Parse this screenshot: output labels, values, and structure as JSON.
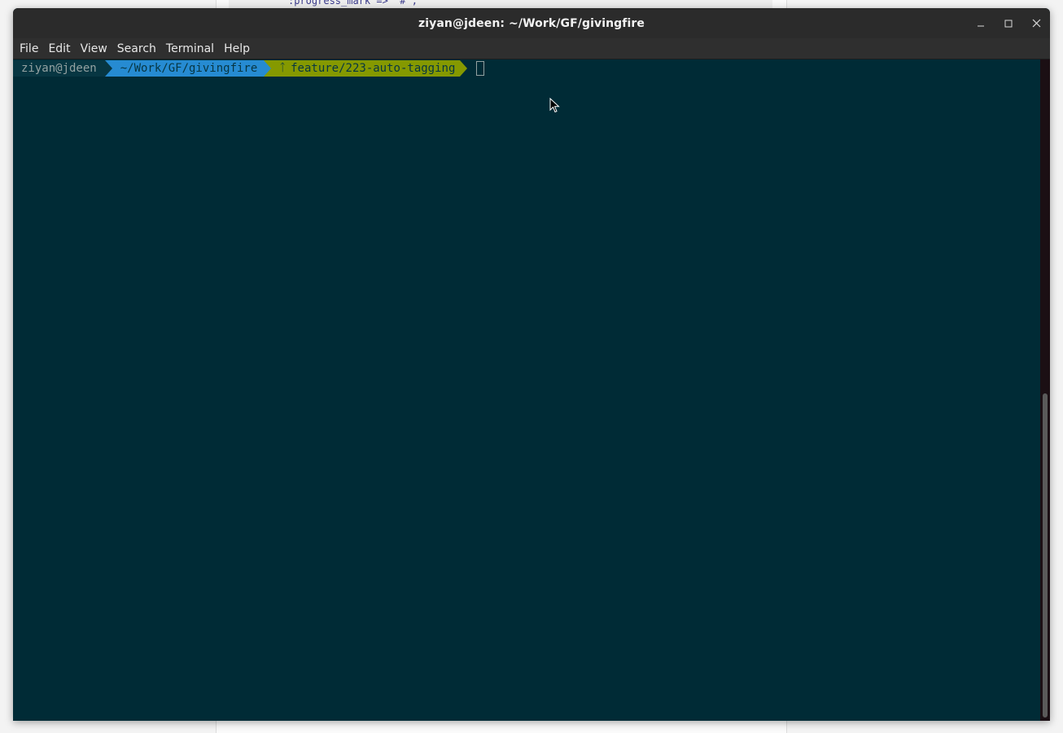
{
  "background": {
    "code_snippet": ":progress_mark => '#',"
  },
  "window": {
    "title": "ziyan@jdeen: ~/Work/GF/givingfire",
    "controls": {
      "minimize_icon": "minimize-icon",
      "maximize_icon": "maximize-icon",
      "close_icon": "close-icon"
    }
  },
  "menubar": {
    "items": [
      "File",
      "Edit",
      "View",
      "Search",
      "Terminal",
      "Help"
    ]
  },
  "terminal": {
    "prompt": {
      "user_host": "ziyan@jdeen",
      "path": "~/Work/GF/givingfire",
      "branch_icon": "ᛏ",
      "branch": "feature/223-auto-tagging"
    },
    "colors": {
      "background": "#002b36",
      "user_segment": "#073642",
      "path_segment": "#268bd2",
      "branch_segment": "#859900",
      "text": "#93a1a1"
    }
  }
}
